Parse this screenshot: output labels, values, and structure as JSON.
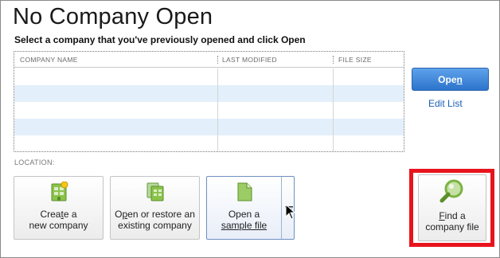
{
  "header": {
    "title": "No Company Open",
    "subtitle": "Select a company that you've previously opened and click Open"
  },
  "table": {
    "columns": [
      "COMPANY NAME",
      "LAST MODIFIED",
      "FILE SIZE"
    ],
    "rows": [
      [
        "",
        "",
        ""
      ],
      [
        "",
        "",
        ""
      ],
      [
        "",
        "",
        ""
      ],
      [
        "",
        "",
        ""
      ],
      [
        "",
        "",
        ""
      ]
    ]
  },
  "actions": {
    "open_prefix": "Ope",
    "open_mnemonic": "n",
    "edit_list": "Edit List"
  },
  "location_label": "LOCATION:",
  "tiles": {
    "create": {
      "line1_pre": "Crea",
      "line1_mn": "t",
      "line1_post": "e a",
      "line2": "new company",
      "icon": "new-company-icon"
    },
    "restore": {
      "line1_pre": "O",
      "line1_mn": "p",
      "line1_post": "en or restore an",
      "line2": "existing company",
      "icon": "restore-company-icon"
    },
    "sample": {
      "line1": "Open a",
      "line2_pre": "",
      "line2_mn": "s",
      "line2_post": "ample file",
      "icon": "sample-file-icon"
    },
    "find": {
      "line1_pre": "",
      "line1_mn": "F",
      "line1_post": "ind a",
      "line2": "company file",
      "icon": "magnifier-icon"
    }
  },
  "colors": {
    "accent": "#2c74cc",
    "row_alt": "#e3effb",
    "highlight": "#e8141d",
    "link": "#1a5fb4",
    "icon_green": "#7cb342"
  }
}
